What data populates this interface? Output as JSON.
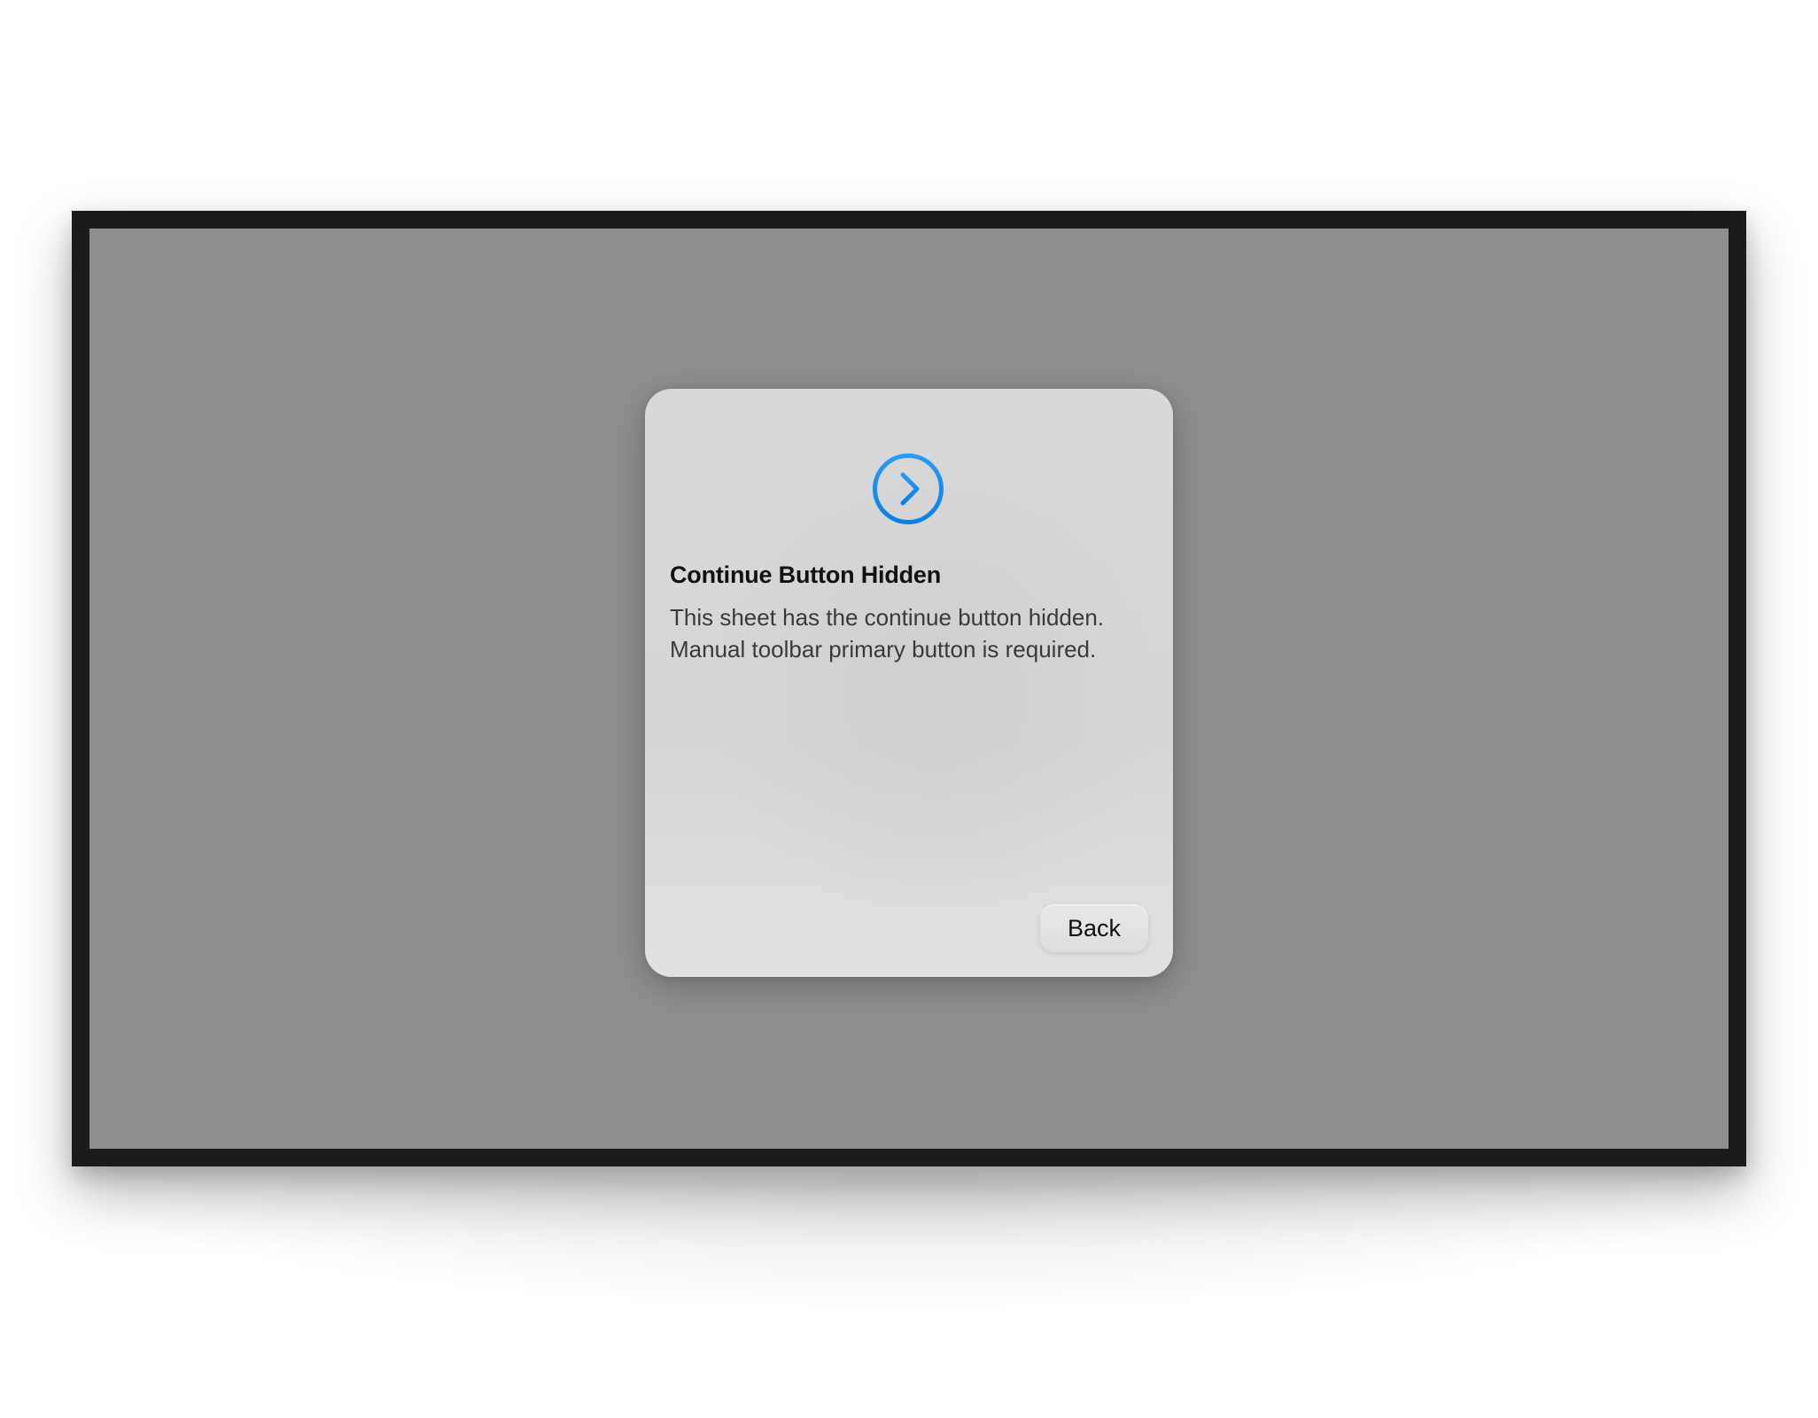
{
  "sheet": {
    "icon": "chevron-right-circle-icon",
    "accent_color": "#1a8cf0",
    "title": "Continue Button Hidden",
    "body": "This sheet has the continue button hidden. Manual toolbar primary button is required.",
    "back_label": "Back"
  },
  "colors": {
    "screen_background": "#8e8e8e",
    "device_bezel": "#1b1b1b",
    "sheet_background": "#d8d8d9"
  }
}
